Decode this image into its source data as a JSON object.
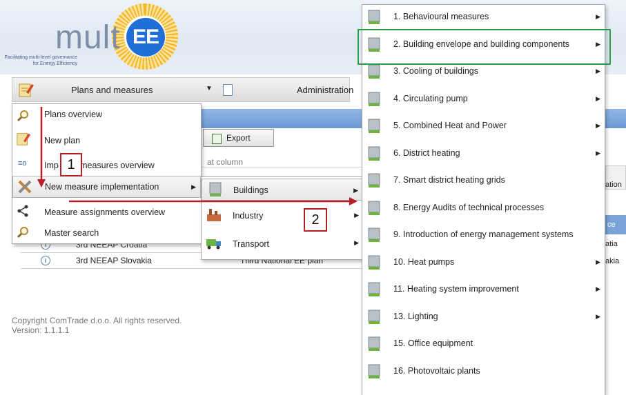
{
  "logo": {
    "word": "mult",
    "badge": "EE",
    "tagline": "Facilitating multi-level governance for Energy Efficiency"
  },
  "nav": {
    "plans_label": "Plans and measures",
    "admin_label": "Administration"
  },
  "plans_menu": {
    "items": [
      {
        "label": "Plans overview",
        "icon": "magnifier-icon"
      },
      {
        "label": "New plan",
        "icon": "pencil-icon"
      },
      {
        "label": "Imp        nted measures overview",
        "icon": "filter-icon"
      },
      {
        "label": "New measure implementation",
        "icon": "tools-icon"
      },
      {
        "label": "Measure assignments overview",
        "icon": "share-icon"
      },
      {
        "label": "Master search",
        "icon": "magnifier-icon"
      }
    ]
  },
  "sector_menu": {
    "items": [
      {
        "label": "Buildings",
        "icon": "building-icon"
      },
      {
        "label": "Industry",
        "icon": "factory-icon"
      },
      {
        "label": "Transport",
        "icon": "truck-icon"
      }
    ]
  },
  "measures_menu": {
    "items": [
      {
        "label": "1. Behavioural measures",
        "submenu": true
      },
      {
        "label": "2. Building envelope and building components",
        "submenu": true
      },
      {
        "label": "3. Cooling of buildings",
        "submenu": true
      },
      {
        "label": "4. Circulating pump",
        "submenu": true
      },
      {
        "label": "5. Combined Heat and Power",
        "submenu": true
      },
      {
        "label": "6. District heating",
        "submenu": true
      },
      {
        "label": "7. Smart district heating grids",
        "submenu": false
      },
      {
        "label": "8. Energy Audits of technical processes",
        "submenu": false
      },
      {
        "label": "9. Introduction of energy management systems",
        "submenu": false
      },
      {
        "label": "10. Heat pumps",
        "submenu": true
      },
      {
        "label": "11. Heating system improvement",
        "submenu": true
      },
      {
        "label": "13. Lighting",
        "submenu": true
      },
      {
        "label": "15. Office equipment",
        "submenu": false
      },
      {
        "label": "16. Photovoltaic plants",
        "submenu": false
      }
    ]
  },
  "page": {
    "export_label": "Export",
    "column_hint": "at column",
    "table_rows": [
      {
        "name": "3rd NEEAP Croatia",
        "type": ""
      },
      {
        "name": "3rd NEEAP Slovakia",
        "type": "Third National EE plan"
      }
    ],
    "right_column_fragments": [
      "ation",
      "ce",
      "atia",
      "akia"
    ],
    "copyright": "Copyright ComTrade d.o.o. All rights reserved.",
    "version": "Version: 1.1.1.1"
  },
  "annotations": {
    "step1": "1",
    "step2": "2",
    "arrow_color": "#b81f24",
    "highlight_color": "#25a046"
  }
}
